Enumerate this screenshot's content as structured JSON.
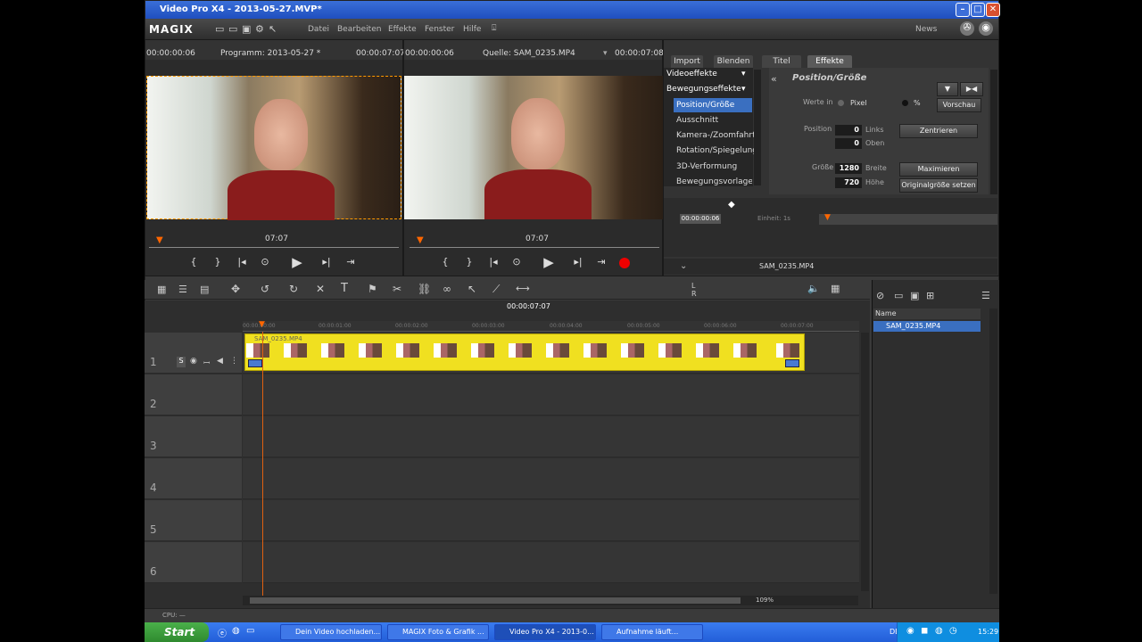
{
  "window": {
    "title": "Video Pro X4 - 2013-05-27.MVP*"
  },
  "menubar": {
    "logo": "MAGIX",
    "items": [
      "Datei",
      "Bearbeiten",
      "Effekte",
      "Fenster",
      "Hilfe"
    ],
    "news": "News"
  },
  "program_monitor": {
    "time_left": "00:00:00:06",
    "title": "Programm: 2013-05-27 *",
    "time_right": "00:00:07:07",
    "ruler_time": "07:07"
  },
  "source_monitor": {
    "time_left": "00:00:00:06",
    "title": "Quelle: SAM_0235.MP4",
    "time_right": "00:00:07:08",
    "ruler_time": "07:07"
  },
  "transport": {
    "mark_in": "{",
    "mark_out": "}",
    "prev": "|◂",
    "loop": "⊙",
    "play": "▶",
    "next": "▸|",
    "end": "⇥"
  },
  "effects_panel": {
    "tabs": [
      "Import",
      "Blenden",
      "Titel",
      "Effekte"
    ],
    "active_tab": "Effekte",
    "categories": [
      "Videoeffekte",
      "Bewegungseffekte"
    ],
    "items": [
      "Position/Größe",
      "Ausschnitt",
      "Kamera-/Zoomfahrt",
      "Rotation/Spiegelung",
      "3D-Verformung",
      "Bewegungsvorlagen"
    ],
    "selected_item": "Position/Größe",
    "heading": "Position/Größe",
    "werte_in": "Werte in",
    "unit_pixel": "Pixel",
    "unit_percent": "%",
    "vorschau": "Vorschau",
    "position_label": "Position",
    "pos_x": "0",
    "pos_x_label": "Links",
    "pos_y": "0",
    "pos_y_label": "Oben",
    "zentrieren": "Zentrieren",
    "size_label": "Größe",
    "width": "1280",
    "width_label": "Breite",
    "height": "720",
    "height_label": "Höhe",
    "maximieren": "Maximieren",
    "originalgroesse": "Originalgröße setzen",
    "keyframe_time": "00:00:00:06",
    "einheit": "Einheit: 1s",
    "clip_name": "SAM_0235.MP4"
  },
  "timeline": {
    "playhead_time": "00:00:07:07",
    "ruler_labels": [
      "00:00:00:00",
      "00:00:01:00",
      "00:00:02:00",
      "00:00:03:00",
      "00:00:04:00",
      "00:00:05:00",
      "00:00:06:00",
      "00:00:07:00"
    ],
    "tracks": [
      "1",
      "2",
      "3",
      "4",
      "5",
      "6"
    ],
    "clip_name": "SAM_0235.MP4",
    "zoom": "109%",
    "track_btns": [
      "S"
    ]
  },
  "media_pool": {
    "column": "Name",
    "file": "SAM_0235.MP4"
  },
  "statusbar": {
    "cpu": "CPU: —"
  },
  "taskbar": {
    "start": "Start",
    "tasks": [
      "Dein Video hochladen...",
      "MAGIX Foto & Grafik ...",
      "Video Pro X4 - 2013-0...",
      "Aufnahme läuft..."
    ],
    "active_task": "Video Pro X4 - 2013-0...",
    "lang": "DE",
    "clock": "15:29"
  }
}
